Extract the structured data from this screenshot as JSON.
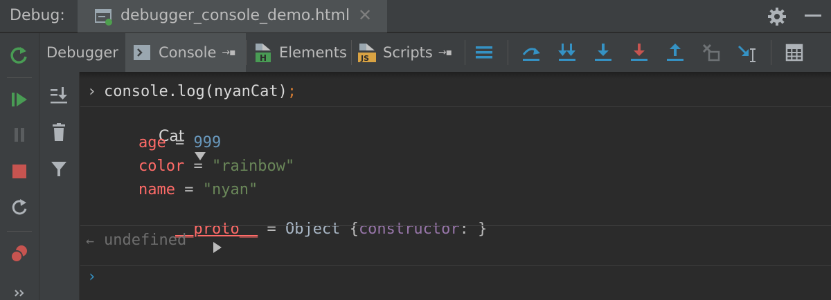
{
  "titlebar": {
    "label": "Debug:",
    "file_tab": "debugger_console_demo.html",
    "close_glyph": "✕"
  },
  "toolbar": {
    "tabs": [
      {
        "label": "Debugger"
      },
      {
        "label": "Console"
      },
      {
        "label": "Elements"
      },
      {
        "label": "Scripts"
      }
    ],
    "pin_glyph": "→▪"
  },
  "console": {
    "command_prompt": "›",
    "command": "console.log(nyanCat)",
    "command_semicolon": ";",
    "object_name": "Cat",
    "fields": [
      {
        "key": "age",
        "eq": " = ",
        "value": "999",
        "type": "num"
      },
      {
        "key": "color",
        "eq": " = ",
        "value": "\"rainbow\"",
        "type": "str"
      },
      {
        "key": "name",
        "eq": " = ",
        "value": "\"nyan\"",
        "type": "str"
      }
    ],
    "proto": {
      "key": "__proto__",
      "eq": " = ",
      "type_name": "Object",
      "open_brace": " {",
      "ctor": "constructor",
      "colon": ": ",
      "close_brace": "}"
    },
    "result_arrow": "←",
    "result": "undefined",
    "input_prompt": "›"
  },
  "colors": {
    "accent_blue": "#3592c4",
    "run_green": "#499c54",
    "stop_red": "#c75450"
  }
}
